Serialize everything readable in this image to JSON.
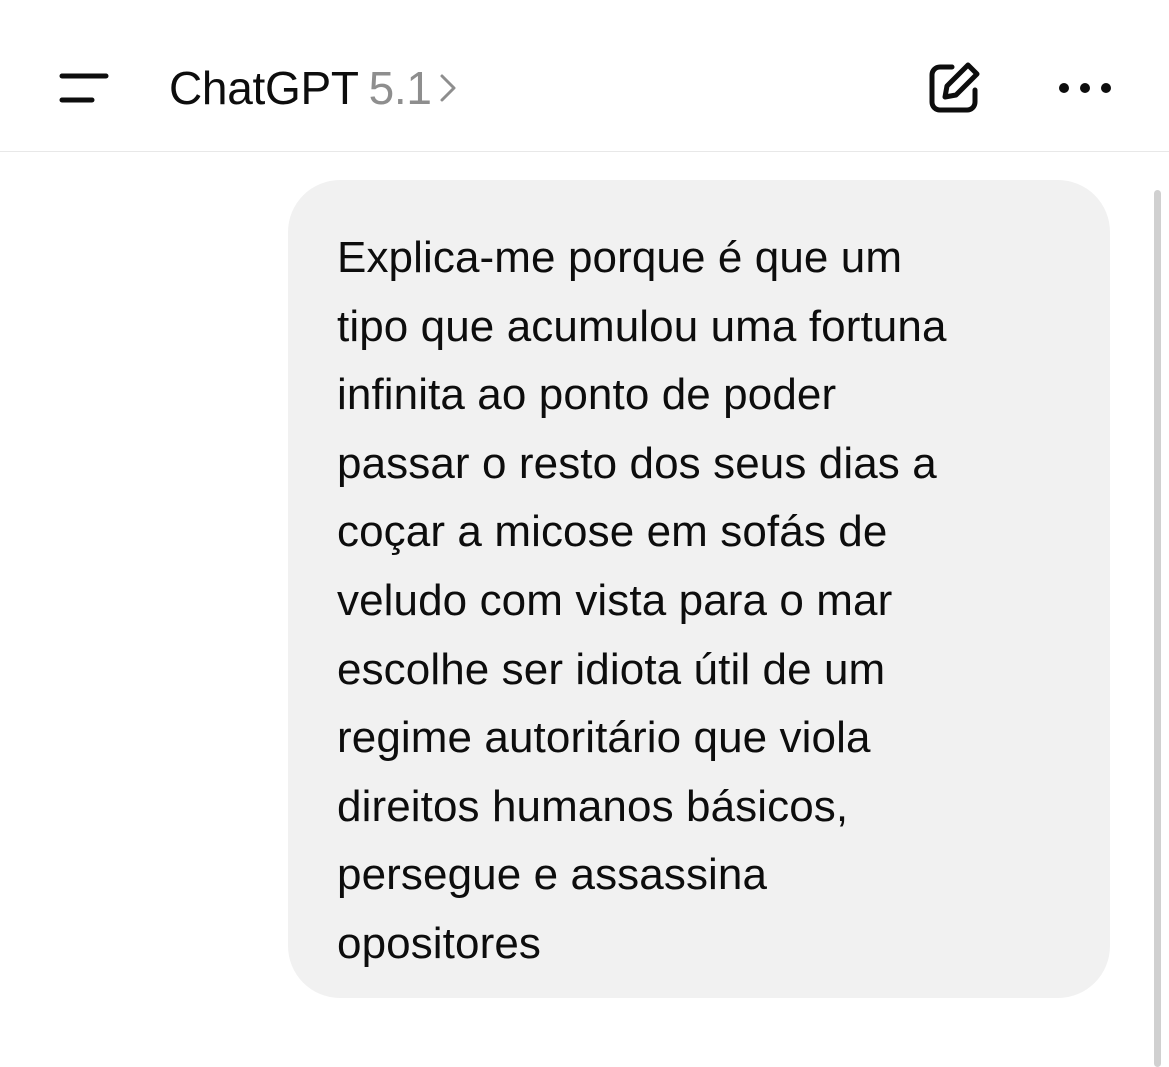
{
  "header": {
    "app_name": "ChatGPT",
    "model_version": "5.1",
    "menu_icon": "sidebar-menu-icon",
    "chevron_icon": "chevron-right-icon",
    "new_chat_icon": "compose-icon",
    "more_icon": "ellipsis-icon"
  },
  "conversation": {
    "messages": [
      {
        "role": "user",
        "text": "Explica-me porque é que um\ntipo que acumulou uma fortuna\ninfinita ao ponto de poder\npassar o resto dos seus dias a\ncoçar a micose em sofás de\nveludo com vista para o mar\nescolhe ser idiota útil de um\nregime autoritário que viola\ndireitos humanos básicos,\npersegue e assassina\nopositores"
      }
    ]
  },
  "colors": {
    "background": "#ffffff",
    "user_bubble": "#f1f1f1",
    "text": "#0d0d0d",
    "version_text": "#8e8e8e",
    "divider": "#e8e8e8"
  }
}
